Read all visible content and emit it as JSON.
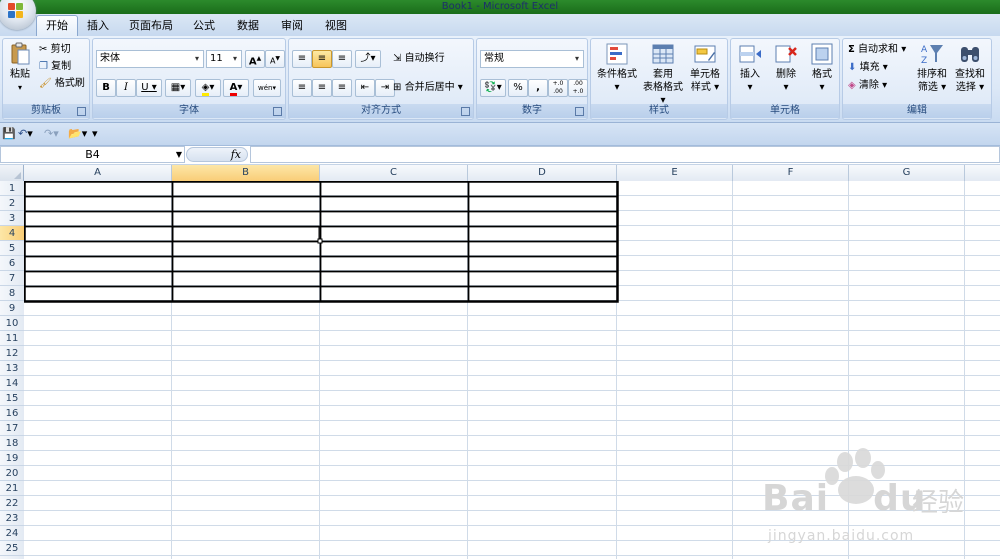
{
  "window": {
    "title": "Book1 - Microsoft Excel"
  },
  "tabs": [
    {
      "label": "开始",
      "active": true
    },
    {
      "label": "插入",
      "active": false
    },
    {
      "label": "页面布局",
      "active": false
    },
    {
      "label": "公式",
      "active": false
    },
    {
      "label": "数据",
      "active": false
    },
    {
      "label": "审阅",
      "active": false
    },
    {
      "label": "视图",
      "active": false
    }
  ],
  "ribbon": {
    "clipboard": {
      "title": "剪贴板",
      "paste": "粘贴",
      "cut": "剪切",
      "copy": "复制",
      "format_painter": "格式刷"
    },
    "font": {
      "title": "字体",
      "font_name": "宋体",
      "font_size": "11",
      "bold": "B",
      "italic": "I",
      "underline": "U",
      "grow": "A",
      "shrink": "A",
      "font_color_letter": "A",
      "phonetic": "wén"
    },
    "alignment": {
      "title": "对齐方式",
      "wrap_text": "自动换行",
      "merge_center": "合并后居中"
    },
    "number": {
      "title": "数字",
      "format": "常规",
      "percent": "%",
      "comma": ",",
      "inc_decimal": "+.0 .00",
      "dec_decimal": ".00 +.0"
    },
    "styles": {
      "title": "样式",
      "conditional": "条件格式",
      "table_style_line1": "套用",
      "table_style_line2": "表格格式",
      "cell_style_line1": "单元格",
      "cell_style_line2": "样式"
    },
    "cells": {
      "title": "单元格",
      "insert": "插入",
      "delete": "删除",
      "format": "格式"
    },
    "editing": {
      "title": "编辑",
      "autosum": "自动求和",
      "fill": "填充",
      "clear": "清除",
      "sort_line1": "排序和",
      "sort_line2": "筛选",
      "find_line1": "查找和",
      "find_line2": "选择"
    }
  },
  "formula_bar": {
    "name_box": "B4",
    "fx": "fx",
    "formula": ""
  },
  "sheet": {
    "columns": [
      "A",
      "B",
      "C",
      "D",
      "E",
      "F",
      "G"
    ],
    "rows": [
      "1",
      "2",
      "3",
      "4",
      "5",
      "6",
      "7",
      "8",
      "9",
      "10",
      "11",
      "12",
      "13",
      "14",
      "15",
      "16",
      "17",
      "18",
      "19",
      "20",
      "21",
      "22",
      "23",
      "24",
      "25"
    ],
    "selected_cell": "B4",
    "selected_column": "B",
    "selected_row": "4"
  },
  "watermark": {
    "brand": "Bai",
    "brand2": "du",
    "cn": "经验",
    "url": "jingyan.baidu.com"
  },
  "colors": {
    "title_green": "#1f7a1f",
    "ribbon_blue": "#dce8f7",
    "grid_line": "#d0dbe8",
    "selection_orange": "#f9cd77"
  }
}
